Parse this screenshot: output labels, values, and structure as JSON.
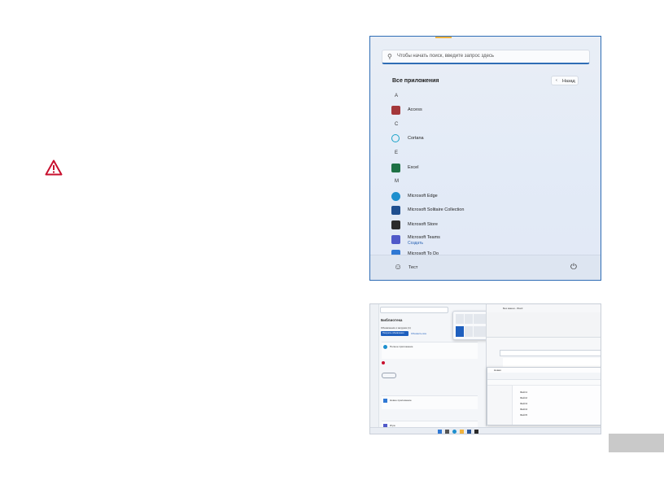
{
  "start_menu": {
    "search_placeholder": "Чтобы начать поиск, введите запрос здесь",
    "section_title": "Все приложения",
    "back_label": "Назад",
    "groups": [
      {
        "letter": "A",
        "apps": [
          {
            "name": "Access",
            "icon": "access-icon",
            "color": "#a4373a"
          }
        ]
      },
      {
        "letter": "C",
        "apps": [
          {
            "name": "Cortana",
            "icon": "cortana-icon",
            "color": "#1aa3c8"
          }
        ]
      },
      {
        "letter": "E",
        "apps": [
          {
            "name": "Excel",
            "icon": "excel-icon",
            "color": "#1e7145"
          }
        ]
      },
      {
        "letter": "M",
        "apps": [
          {
            "name": "Microsoft Edge",
            "icon": "edge-icon",
            "color": "#1d8fce"
          },
          {
            "name": "Microsoft Solitaire Collection",
            "icon": "solitaire-icon",
            "color": "#1f4f8f"
          },
          {
            "name": "Microsoft Store",
            "icon": "store-icon",
            "color": "#2b2b2b"
          },
          {
            "name": "Microsoft Teams",
            "sub": "Создать",
            "icon": "teams-icon",
            "color": "#5059c9"
          },
          {
            "name": "Microsoft To Do",
            "icon": "todo-icon",
            "color": "#2f78d4"
          }
        ]
      }
    ],
    "user_name": "Тест",
    "accent_color": "#2f6db5"
  },
  "screenshot2": {
    "store": {
      "title": "Библиотека",
      "updates": "Обновления и загрузки (1)",
      "get_updates": "Получить обновления",
      "check": "Обновить все",
      "items": [
        "Полное приложение",
        "Новое приложение",
        "Игра"
      ]
    },
    "word_title": "Без имени - Word",
    "explorer_title": "Новая",
    "files": [
      "Файл1",
      "Файл2",
      "Файл3",
      "Файл4",
      "Файл5"
    ]
  }
}
